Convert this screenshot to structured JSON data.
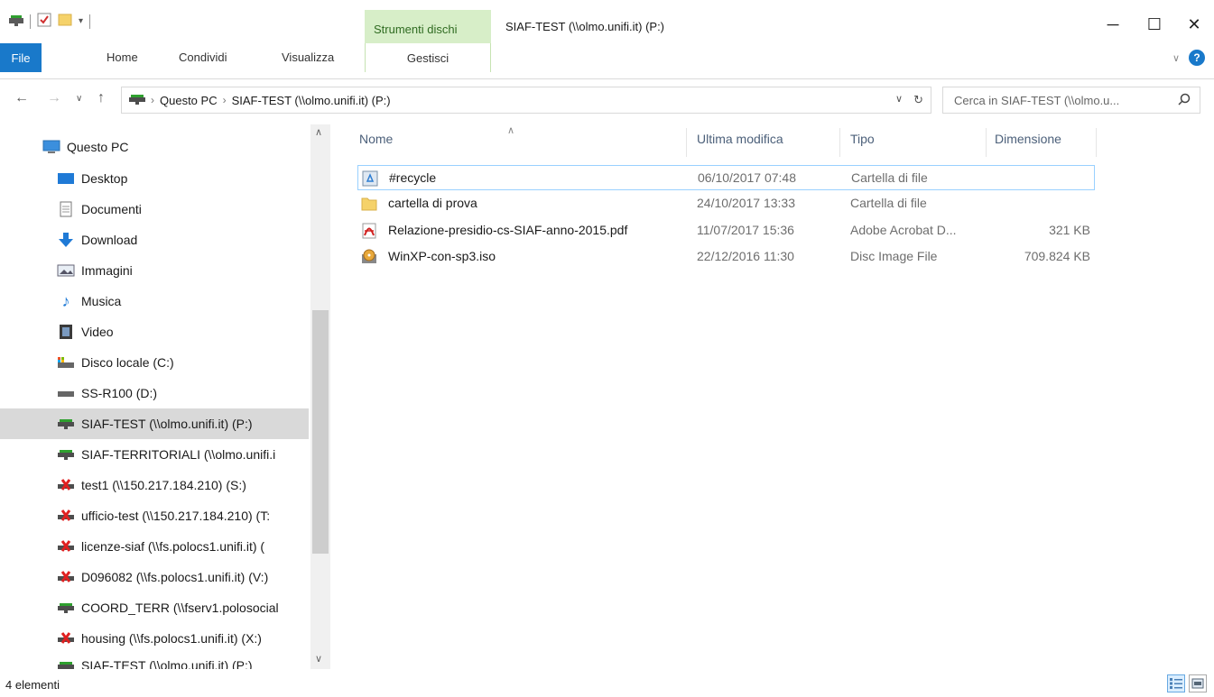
{
  "window": {
    "title": "SIAF-TEST (\\\\olmo.unifi.it) (P:)",
    "context_tab_title": "Strumenti dischi"
  },
  "ribbon": {
    "tabs": [
      "File",
      "Home",
      "Condividi",
      "Visualizza"
    ],
    "context_tab": "Gestisci"
  },
  "address": {
    "crumbs": [
      "Questo PC",
      "SIAF-TEST (\\\\olmo.unifi.it) (P:)"
    ],
    "search_placeholder": "Cerca in SIAF-TEST (\\\\olmo.u..."
  },
  "nav": {
    "items": [
      {
        "label": "Questo PC",
        "icon": "pc-icon"
      },
      {
        "label": "Desktop",
        "icon": "desktop-icon"
      },
      {
        "label": "Documenti",
        "icon": "documents-icon"
      },
      {
        "label": "Download",
        "icon": "download-icon"
      },
      {
        "label": "Immagini",
        "icon": "pictures-icon"
      },
      {
        "label": "Musica",
        "icon": "music-icon"
      },
      {
        "label": "Video",
        "icon": "video-icon"
      },
      {
        "label": "Disco locale (C:)",
        "icon": "local-disk-icon"
      },
      {
        "label": "SS-R100 (D:)",
        "icon": "drive-icon"
      },
      {
        "label": "SIAF-TEST (\\\\olmo.unifi.it) (P:)",
        "icon": "network-drive-icon"
      },
      {
        "label": "SIAF-TERRITORIALI (\\\\olmo.unifi.i",
        "icon": "network-drive-icon"
      },
      {
        "label": "test1 (\\\\150.217.184.210) (S:)",
        "icon": "disconnected-drive-icon"
      },
      {
        "label": "ufficio-test (\\\\150.217.184.210) (T:",
        "icon": "disconnected-drive-icon"
      },
      {
        "label": "licenze-siaf (\\\\fs.polocs1.unifi.it) (",
        "icon": "disconnected-drive-icon"
      },
      {
        "label": "D096082 (\\\\fs.polocs1.unifi.it) (V:)",
        "icon": "disconnected-drive-icon"
      },
      {
        "label": "COORD_TERR (\\\\fserv1.polosocial",
        "icon": "network-drive-icon"
      },
      {
        "label": "housing (\\\\fs.polocs1.unifi.it) (X:)",
        "icon": "disconnected-drive-icon"
      },
      {
        "label": "SIAF-TEST (\\\\olmo.unifi.it) (P:)",
        "icon": "network-drive-icon"
      }
    ]
  },
  "list": {
    "columns": [
      "Nome",
      "Ultima modifica",
      "Tipo",
      "Dimensione"
    ],
    "rows": [
      {
        "name": "#recycle",
        "date": "06/10/2017 07:48",
        "type": "Cartella di file",
        "size": "",
        "icon": "recycle-folder-icon"
      },
      {
        "name": "cartella di prova",
        "date": "24/10/2017 13:33",
        "type": "Cartella di file",
        "size": "",
        "icon": "folder-icon"
      },
      {
        "name": "Relazione-presidio-cs-SIAF-anno-2015.pdf",
        "date": "11/07/2017 15:36",
        "type": "Adobe Acrobat D...",
        "size": "321 KB",
        "icon": "pdf-icon"
      },
      {
        "name": "WinXP-con-sp3.iso",
        "date": "22/12/2016 11:30",
        "type": "Disc Image File",
        "size": "709.824 KB",
        "icon": "disc-image-icon"
      }
    ]
  },
  "status": {
    "count": "4 elementi"
  }
}
